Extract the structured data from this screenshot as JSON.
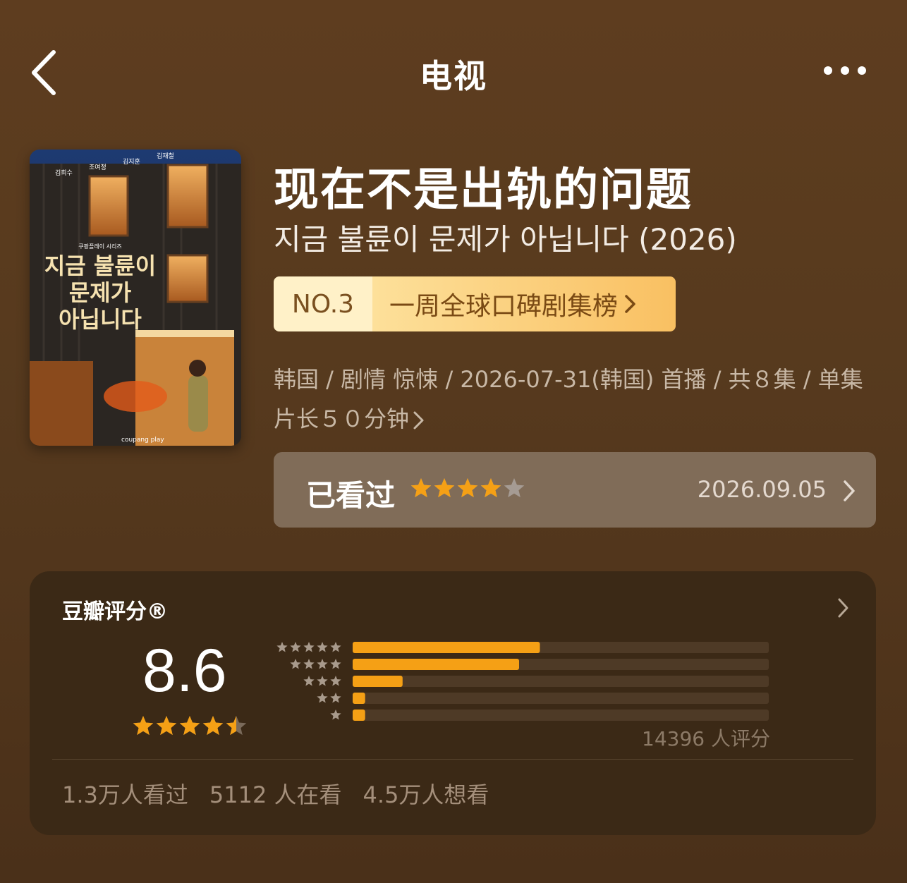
{
  "header": {
    "title": "电视"
  },
  "poster": {
    "cast": [
      "김희수",
      "조여정",
      "김지훈",
      "김재철"
    ],
    "series_tag": "쿠팡플레이 시리즈",
    "title_lines": [
      "지금 불륜이",
      "문제가",
      "아닙니다"
    ],
    "platform": "coupang play"
  },
  "show": {
    "title": "现在不是出轨的问题",
    "original_title": "지금 불륜이 문제가 아닙니다 (2026)",
    "rank_no": "NO.3",
    "rank_list": "一周全球口碑剧集榜",
    "meta_line": "韩国 / 剧情 惊悚 / 2026-07-31(韩国) 首播 / 共８集 / 单集片长５０分钟"
  },
  "watched": {
    "label": "已看过",
    "date": "2026.09.05",
    "user_rating": 4,
    "max_rating": 5
  },
  "rating": {
    "title": "豆瓣评分®",
    "score": "8.6",
    "stars": 4.5,
    "distribution": [
      {
        "stars": 5,
        "percent": 45
      },
      {
        "stars": 4,
        "percent": 40
      },
      {
        "stars": 3,
        "percent": 12
      },
      {
        "stars": 2,
        "percent": 3
      },
      {
        "stars": 1,
        "percent": 3
      }
    ],
    "raters_text": "14396 人评分",
    "counts": [
      "1.3万人看过",
      "5112 人在看",
      "4.5万人想看"
    ]
  },
  "colors": {
    "accent": "#f5a015",
    "rank_bg": "#fde09a",
    "card_bg": "#3b2916"
  }
}
